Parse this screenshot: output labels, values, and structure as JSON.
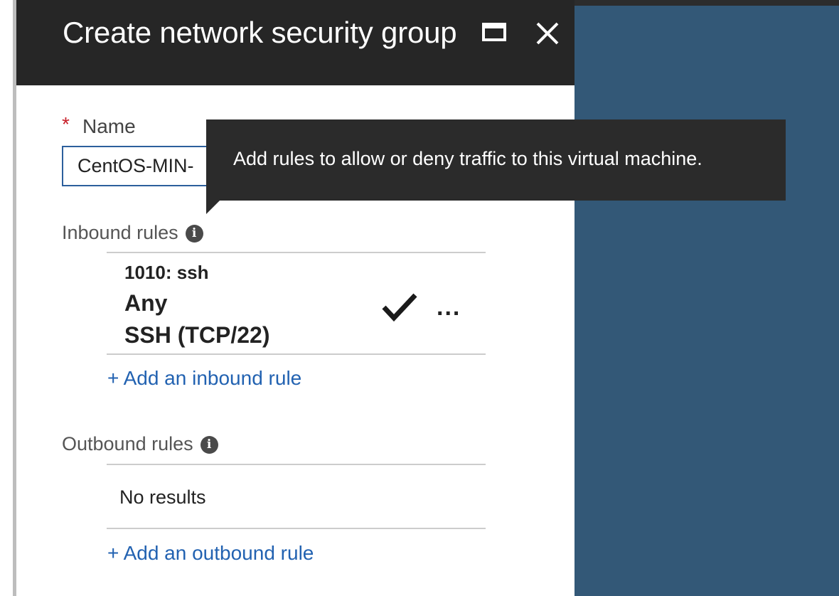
{
  "blade": {
    "title": "Create network security group",
    "maximize_icon": "maximize-icon",
    "close_icon": "close-icon"
  },
  "name_field": {
    "required_marker": "*",
    "label": "Name",
    "value": "CentOS-MIN-"
  },
  "tooltip": {
    "text": "Add rules to allow or deny traffic to this virtual machine."
  },
  "inbound": {
    "label": "Inbound rules",
    "info_icon": "info-icon",
    "rules": [
      {
        "name": "1010: ssh",
        "source": "Any",
        "service": "SSH (TCP/22)",
        "action_icon": "check-icon",
        "more_label": "..."
      }
    ],
    "add_link": "+ Add an inbound rule"
  },
  "outbound": {
    "label": "Outbound rules",
    "info_icon": "info-icon",
    "empty_text": "No results",
    "add_link": "+ Add an outbound rule"
  },
  "colors": {
    "header_bg": "#262626",
    "side_panel": "#335877",
    "link": "#2262b1",
    "required": "#c8202a",
    "input_border": "#2c5f9c"
  }
}
